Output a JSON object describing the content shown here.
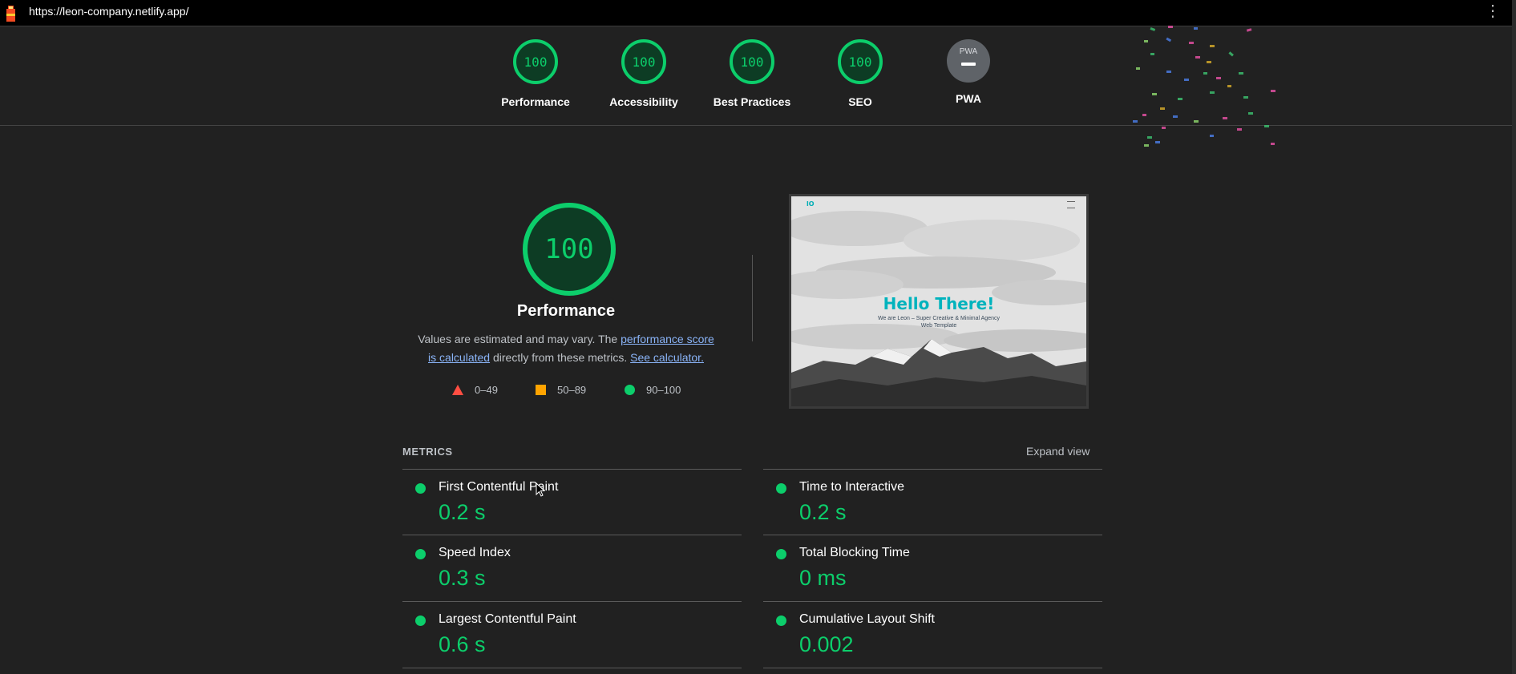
{
  "address_bar": {
    "url": "https://leon-company.netlify.app/"
  },
  "summary_gauges": [
    {
      "label": "Performance",
      "score": "100"
    },
    {
      "label": "Accessibility",
      "score": "100"
    },
    {
      "label": "Best Practices",
      "score": "100"
    },
    {
      "label": "SEO",
      "score": "100"
    },
    {
      "label": "PWA",
      "badge_text": "PWA"
    }
  ],
  "performance": {
    "score": "100",
    "title": "Performance",
    "desc_1": "Values are estimated and may vary. The ",
    "link_1": "performance score is calculated",
    "desc_2": " directly from these metrics. ",
    "link_2": "See calculator.",
    "legend": [
      {
        "range": "0–49",
        "color": "#ff4e42",
        "shape": "triangle"
      },
      {
        "range": "50–89",
        "color": "#ffa400",
        "shape": "square"
      },
      {
        "range": "90–100",
        "color": "#0cce6b",
        "shape": "circle"
      }
    ]
  },
  "screenshot": {
    "logo": "lO",
    "hero_title": "Hello There!",
    "hero_subtitle": "We are Leon – Super Creative & Minimal Agency Web Template"
  },
  "metrics": {
    "header": "METRICS",
    "expand_label": "Expand view",
    "items": [
      {
        "name": "First Contentful Paint",
        "value": "0.2 s"
      },
      {
        "name": "Time to Interactive",
        "value": "0.2 s"
      },
      {
        "name": "Speed Index",
        "value": "0.3 s"
      },
      {
        "name": "Total Blocking Time",
        "value": "0 ms"
      },
      {
        "name": "Largest Contentful Paint",
        "value": "0.6 s"
      },
      {
        "name": "Cumulative Layout Shift",
        "value": "0.002"
      }
    ]
  },
  "colors": {
    "pass": "#0cce6b",
    "background": "#212121",
    "link": "#8ab4f8"
  }
}
